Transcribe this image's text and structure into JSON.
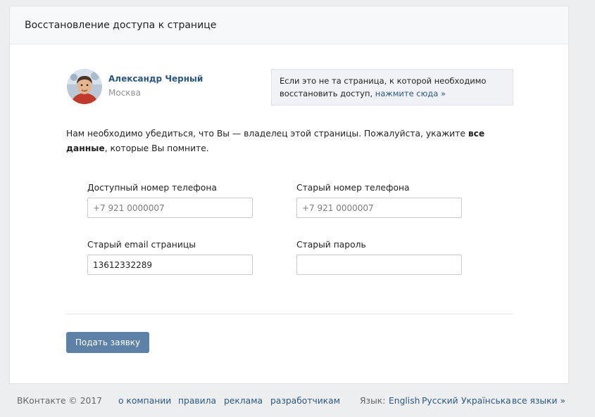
{
  "header": {
    "title": "Восстановление доступа к странице"
  },
  "user": {
    "name": "Александр Черный",
    "city": "Москва"
  },
  "note": {
    "text": "Если это не та страница, к которой необходимо восстановить доступ,",
    "link": "нажмите сюда »"
  },
  "intro": {
    "part1": "Нам необходимо убедиться, что Вы — владелец этой страницы. Пожалуйста, укажите",
    "bold": "все данные",
    "part2": ", которые Вы помните."
  },
  "form": {
    "phone_label": "Доступный номер телефона",
    "phone_placeholder": "+7 921 0000007",
    "old_phone_label": "Старый номер телефона",
    "old_phone_placeholder": "+7 921 0000007",
    "email_label": "Старый email страницы",
    "email_value": "13612332289",
    "password_label": "Старый пароль",
    "password_value": ""
  },
  "submit": {
    "label": "Подать заявку"
  },
  "footer": {
    "copyright": "ВКонтакте © 2017",
    "links": [
      "о компании",
      "правила",
      "реклама",
      "разработчикам"
    ],
    "lang_label": "Язык:",
    "languages": [
      "English",
      "Русский",
      "Українська",
      "все языки »"
    ]
  },
  "colors": {
    "link": "#2a5885",
    "button": "#5e81a8",
    "page_bg": "#edeef0"
  },
  "icons": {
    "avatar": "user-avatar-photo"
  }
}
